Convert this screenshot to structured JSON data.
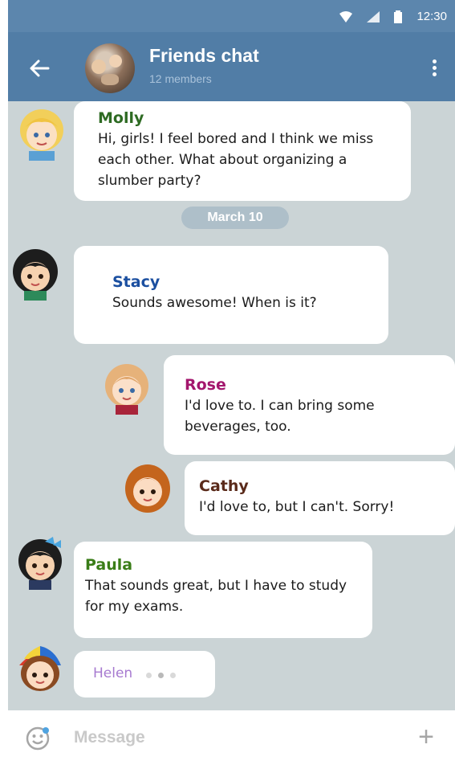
{
  "status_bar": {
    "time": "12:30"
  },
  "header": {
    "title": "Friends chat",
    "subtitle": "12 members"
  },
  "date_divider": "March 10",
  "messages": [
    {
      "sender": "Molly",
      "text": "Hi, girls! I feel bored and I think we miss each other. What about organizing a slumber party?",
      "name_color": "#2e6b23"
    },
    {
      "sender": "Stacy",
      "text": "Sounds awesome! When is it?",
      "name_color": "#1b4fa0"
    },
    {
      "sender": "Rose",
      "text": "I'd love to. I can bring some beverages, too.",
      "name_color": "#a3166d"
    },
    {
      "sender": "Cathy",
      "text": "I'd love to, but I can't. Sorry!",
      "name_color": "#5a2a1a"
    },
    {
      "sender": "Paula",
      "text": "That sounds great, but I have to study for my exams.",
      "name_color": "#3a7d18"
    },
    {
      "sender": "Helen",
      "text": "",
      "name_color": "#a77ad0"
    }
  ],
  "input": {
    "placeholder": "Message"
  },
  "colors": {
    "header": "#517da6",
    "chat_background": "#cbd4d6",
    "bubble": "#ffffff"
  }
}
